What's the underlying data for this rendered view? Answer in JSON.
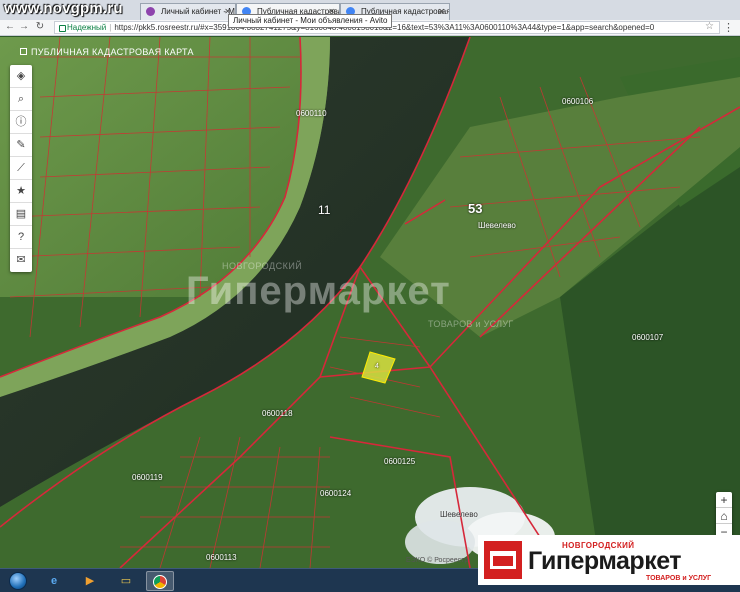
{
  "watermark_site": "www.novgpm.ru",
  "browser": {
    "tabs": [
      {
        "label": "Личный кабинет - Мои",
        "favicon_color": "#8e44ad"
      },
      {
        "label": "Публичная кадастровая",
        "favicon_color": "#4285f4"
      },
      {
        "label": "Публичная кадастровая",
        "favicon_color": "#4285f4"
      }
    ],
    "tooltip": "Личный кабинет - Мои объявления - Avito",
    "secure_label": "Надежный",
    "url": "https://pkk5.rosreestr.ru/#x=3591804.3832741275&y=8160848.4808158018&z=16&text=53%3A11%3A0600110%3A44&type=1&app=search&opened=0"
  },
  "map": {
    "title": "ПУБЛИЧНАЯ КАДАСТРОВАЯ КАРТА",
    "toolbar_icons": [
      "layers-icon",
      "search-icon",
      "info-icon",
      "pencil-icon",
      "ruler-icon",
      "star-icon",
      "print-icon",
      "help-icon",
      "mail-icon"
    ],
    "zoom": {
      "in": "+",
      "out": "−",
      "home": "⌂"
    },
    "labels": {
      "river_zone": "11",
      "region": "53",
      "village_north": "Шевелево",
      "village_south": "Шевелево",
      "q1": "0600110",
      "q2": "0600106",
      "q3": "0600107",
      "q4": "0600125",
      "q5": "0600118",
      "q6": "0600119",
      "q7": "0600113",
      "q8": "0600124",
      "parcel_selected": "4",
      "copyright": "ЕЭКО © Росреестр"
    },
    "watermark": {
      "top": "НОВГОРОДСКИЙ",
      "main": "Гипермаркет",
      "sub": "ТОВАРОВ и УСЛУГ"
    }
  },
  "logo": {
    "top": "НОВГОРОДСКИЙ",
    "main": "Гипермаркет",
    "sub": "ТОВАРОВ и УСЛУГ"
  },
  "taskbar": {
    "items": [
      "start-button",
      "ie-icon",
      "media-player-icon",
      "explorer-folder-icon",
      "chrome-icon"
    ]
  }
}
